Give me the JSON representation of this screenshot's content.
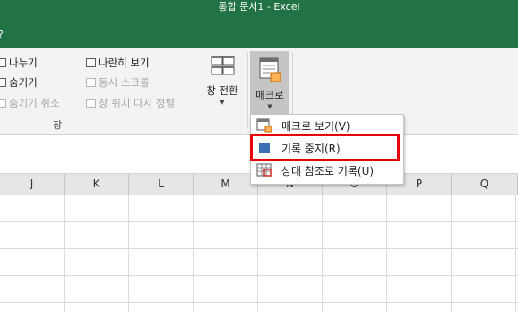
{
  "window": {
    "title": "통합 문서1  -  Excel",
    "help_glyph": "?",
    "accent": "#217346"
  },
  "ribbon": {
    "window_group": {
      "label": "창",
      "split": "나누기",
      "hide": "숨기기",
      "unhide": "숨기기 취소",
      "side_by_side": "나란히 보기",
      "sync_scroll": "동시 스크롤",
      "reset_position": "창 위치 다시 정렬",
      "switch_windows": "창 전환"
    },
    "macros": {
      "label": "매크로"
    }
  },
  "macro_menu": {
    "items": [
      {
        "label": "매크로 보기(V)",
        "icon": "view-macros-icon"
      },
      {
        "label": "기록 중지(R)",
        "icon": "stop-recording-icon"
      },
      {
        "label": "상대 참조로 기록(U)",
        "icon": "relative-reference-icon"
      }
    ],
    "highlight_color": "#e8000b"
  },
  "columns": [
    "J",
    "K",
    "L",
    "M",
    "N",
    "O",
    "P",
    "Q"
  ]
}
